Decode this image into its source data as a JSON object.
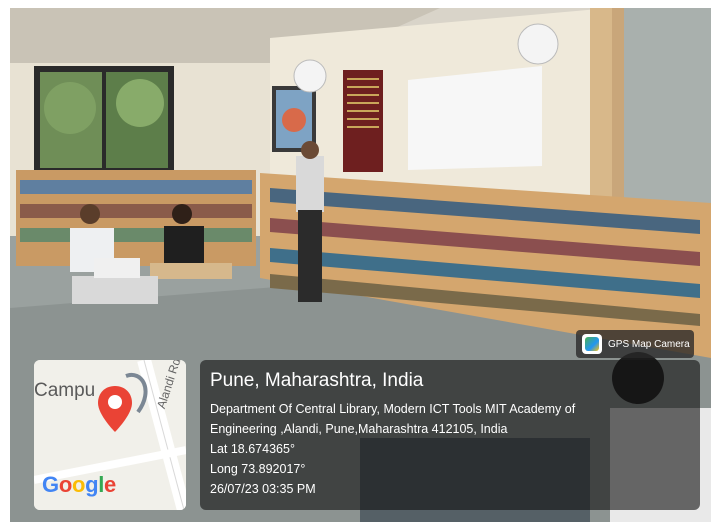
{
  "badge": {
    "app_name": "GPS Map Camera",
    "logo_icon": "gps-map-camera-logo-icon"
  },
  "map": {
    "place_label": "Campu",
    "road_label": "Alandi Rd",
    "brand": [
      "G",
      "o",
      "o",
      "g",
      "l",
      "e"
    ],
    "brand_colors": [
      "#4285F4",
      "#EA4335",
      "#FBBC05",
      "#4285F4",
      "#34A853",
      "#EA4335"
    ],
    "pin_color": "#EA4335",
    "pin_icon": "location-pin-icon"
  },
  "location": {
    "title": "Pune, Maharashtra, India",
    "address_line1": "Department Of Central Library, Modern ICT Tools MIT Academy of",
    "address_line2": "Engineering ,Alandi, Pune,Maharashtra 412105, India",
    "latitude": "Lat 18.674365°",
    "longitude": "Long 73.892017°",
    "timestamp": "26/07/23 03:35 PM"
  }
}
